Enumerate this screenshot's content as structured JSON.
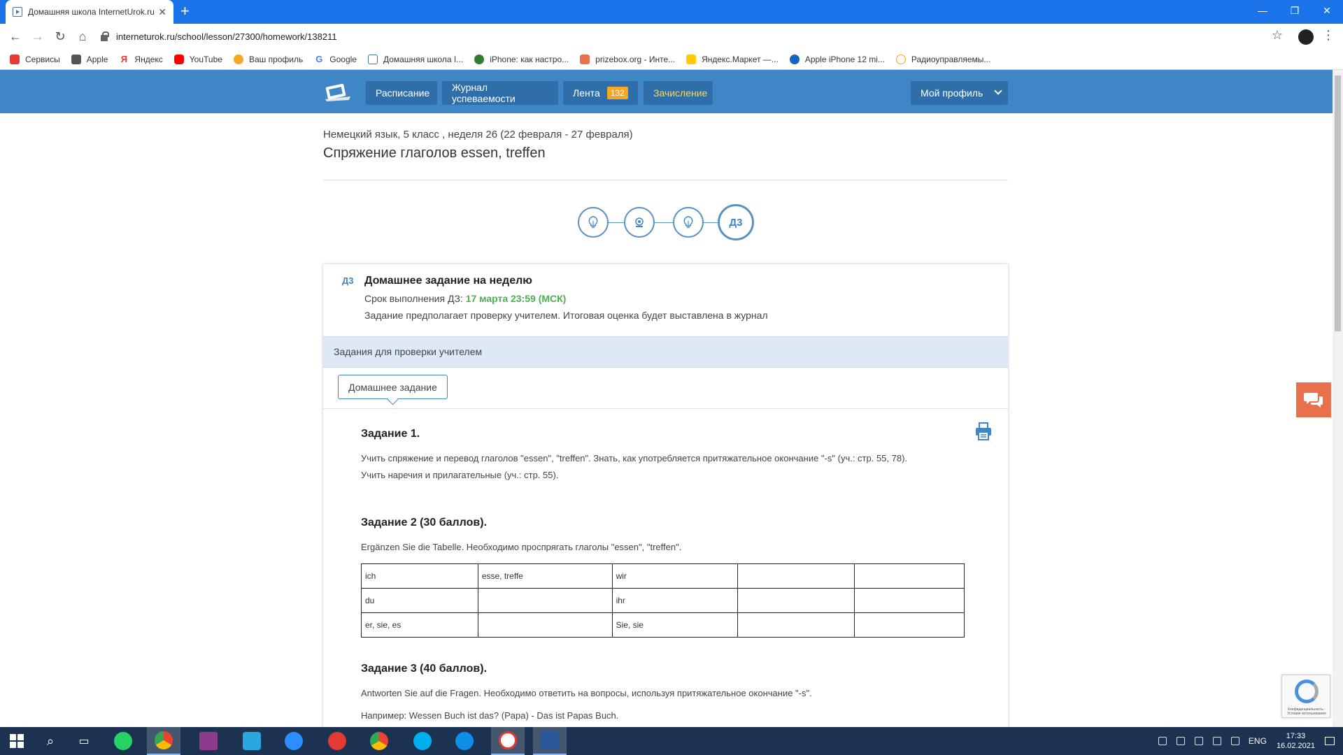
{
  "browser": {
    "tab_title": "Домашняя школа InternetUrok.ru",
    "url": "interneturok.ru/school/lesson/27300/homework/138211"
  },
  "bookmarks": [
    {
      "label": "Сервисы",
      "color": "#e53935"
    },
    {
      "label": "Apple",
      "color": "#555555"
    },
    {
      "label": "Яндекс",
      "color": "#e53935"
    },
    {
      "label": "YouTube",
      "color": "#ff0000"
    },
    {
      "label": "Ваш профиль",
      "color": "#f5a623"
    },
    {
      "label": "Google",
      "color": "#4285f4"
    },
    {
      "label": "Домашняя школа I...",
      "color": "#4a6fa5"
    },
    {
      "label": "iPhone: как настро...",
      "color": "#2e7d32"
    },
    {
      "label": "prizebox.org - Инте...",
      "color": "#e8704d"
    },
    {
      "label": "Яндекс.Маркет —...",
      "color": "#ffcc00"
    },
    {
      "label": "Apple iPhone 12 mi...",
      "color": "#1565c0"
    },
    {
      "label": "Радиоуправляемы...",
      "color": "#f5a623"
    }
  ],
  "site_nav": {
    "schedule": "Расписание",
    "journal": "Журнал успеваемости",
    "feed": "Лента",
    "feed_badge": "132",
    "enrollment": "Зачисление",
    "profile": "Мой профиль"
  },
  "lesson": {
    "course": "Немецкий язык, 5 класс , неделя 26 (22 февраля - 27 февраля)",
    "title": "Спряжение глаголов essen, treffen"
  },
  "stepper": {
    "steps": [
      "lightbulb",
      "webcam",
      "lightbulb",
      "Д3"
    ]
  },
  "homework": {
    "label": "Д3",
    "title": "Домашнее задание на неделю",
    "deadline_prefix": "Срок выполнения ДЗ:",
    "deadline_value": "17 марта 23:59 (МСК)",
    "note": "Задание предполагает проверку учителем. Итоговая оценка будет выставлена в журнал",
    "teacher_band": "Задания для проверки учителем",
    "tab": "Домашнее задание"
  },
  "tasks": {
    "t1_title": "Задание 1.",
    "t1_line1": "Учить спряжение и перевод глаголов \"essen\", \"treffen\". Знать, как употребляется притяжательное окончание \"-s\" (уч.: стр. 55, 78).",
    "t1_line2": "Учить наречия и прилагательные (уч.: стр. 55).",
    "t2_title": "Задание 2 (30 баллов).",
    "t2_text": "Ergänzen Sie die Tabelle. Необходимо проспрягать глаголы \"essen\", \"treffen\".",
    "table": [
      [
        "ich",
        "esse, treffe",
        "wir",
        "",
        ""
      ],
      [
        "du",
        "",
        "ihr",
        "",
        ""
      ],
      [
        "er, sie, es",
        "",
        "Sie, sie",
        "",
        ""
      ]
    ],
    "t3_title": "Задание 3 (40 баллов).",
    "t3_text": "Antworten Sie auf die Fragen. Необходимо ответить на вопросы, используя притяжательное окончание \"-s\".",
    "t3_example": "Например: Wessen Buch ist das? (Papa) - Das ist Papas Buch."
  },
  "recaptcha_text": "Конфиденциальность - Условия использования",
  "taskbar": {
    "lang": "ENG",
    "time": "17:33",
    "date": "16.02.2021"
  },
  "colors": {
    "chrome_blue": "#1a73e8",
    "site_blue": "#3e86c6",
    "nav_button": "#2f6ea8",
    "enrollment_text": "#ffd84a",
    "badge": "#f5a623",
    "deadline_green": "#4caf50",
    "chat_orange": "#e8704d",
    "taskbar": "#1b3350"
  }
}
